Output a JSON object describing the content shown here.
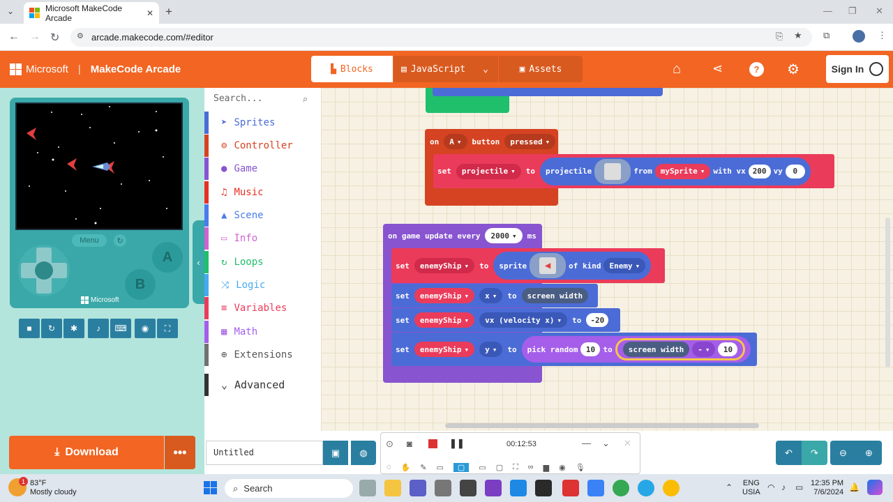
{
  "browser": {
    "tab_title": "Microsoft MakeCode Arcade",
    "url": "arcade.makecode.com/#editor"
  },
  "header": {
    "brand": "Microsoft",
    "product": "MakeCode Arcade",
    "blocks_tab": "Blocks",
    "js_tab": "JavaScript",
    "assets_tab": "Assets",
    "sign_in": "Sign In"
  },
  "simulator": {
    "menu_label": "Menu",
    "a_label": "A",
    "b_label": "B",
    "brand": "Microsoft"
  },
  "toolbox": {
    "search_placeholder": "Search...",
    "categories": [
      {
        "label": "Sprites",
        "color": "#4b6cd6"
      },
      {
        "label": "Controller",
        "color": "#d54322"
      },
      {
        "label": "Game",
        "color": "#8854d0"
      },
      {
        "label": "Music",
        "color": "#e63022"
      },
      {
        "label": "Scene",
        "color": "#4b7bec"
      },
      {
        "label": "Info",
        "color": "#cf63cf"
      },
      {
        "label": "Loops",
        "color": "#20bf6b"
      },
      {
        "label": "Logic",
        "color": "#45aaf2"
      },
      {
        "label": "Variables",
        "color": "#eb3b5a"
      },
      {
        "label": "Math",
        "color": "#a55eea"
      },
      {
        "label": "Extensions",
        "color": "#717171"
      }
    ],
    "advanced": "Advanced"
  },
  "blocks": {
    "on": "on",
    "a_dropdown": "A",
    "button": "button",
    "pressed": "pressed",
    "set": "set",
    "projectile_var": "projectile",
    "to": "to",
    "projectile": "projectile",
    "from": "from",
    "mysprite": "mySprite",
    "with_vx": "with vx",
    "vx_val": "200",
    "vy": "vy",
    "vy_val": "0",
    "on_game_update": "on game update every",
    "interval": "2000",
    "ms": "ms",
    "enemyship": "enemyShip",
    "sprite": "sprite",
    "of_kind": "of kind",
    "kind": "Enemy",
    "x": "x",
    "screen_width": "screen width",
    "vx_velocity": "vx (velocity x)",
    "minus20": "-20",
    "y": "y",
    "pick_random": "pick random",
    "rand_from": "10",
    "minus_op": "-",
    "sub_val": "10"
  },
  "bottom": {
    "download": "Download",
    "project_name": "Untitled"
  },
  "recorder": {
    "time": "00:12:53"
  },
  "taskbar": {
    "temp": "83°F",
    "weather": "Mostly cloudy",
    "badge": "1",
    "search": "Search",
    "lang": "ENG",
    "region": "USIA",
    "time": "12:35 PM",
    "date": "7/6/2024"
  },
  "colors": {
    "orange": "#f26522",
    "teal": "#3aa8a8",
    "events": "#d54322",
    "sprites": "#4b6cd6",
    "game": "#8854d0",
    "variables": "#eb3b5a"
  }
}
